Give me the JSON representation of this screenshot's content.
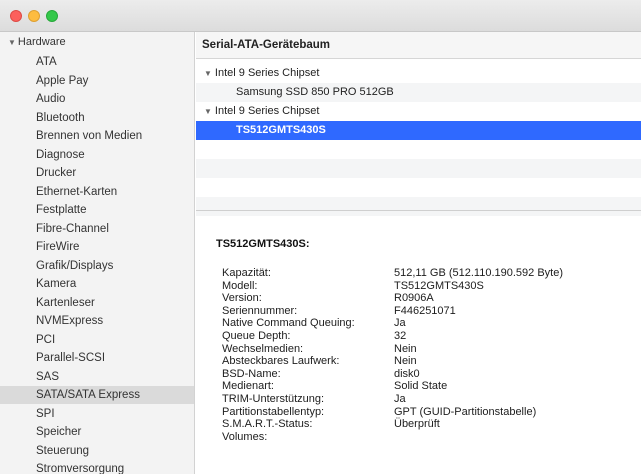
{
  "sidebar": {
    "header": "Hardware",
    "items": [
      "ATA",
      "Apple Pay",
      "Audio",
      "Bluetooth",
      "Brennen von Medien",
      "Diagnose",
      "Drucker",
      "Ethernet-Karten",
      "Festplatte",
      "Fibre-Channel",
      "FireWire",
      "Grafik/Displays",
      "Kamera",
      "Kartenleser",
      "NVMExpress",
      "PCI",
      "Parallel-SCSI",
      "SAS",
      "SATA/SATA Express",
      "SPI",
      "Speicher",
      "Steuerung",
      "Stromversorgung"
    ],
    "selected": "SATA/SATA Express"
  },
  "main": {
    "header": "Serial-ATA-Gerätebaum",
    "tree": [
      {
        "label": "Intel 9 Series Chipset",
        "kind": "group"
      },
      {
        "label": "Samsung SSD 850 PRO 512GB",
        "kind": "device"
      },
      {
        "label": "Intel 9 Series Chipset",
        "kind": "group"
      },
      {
        "label": "TS512GMTS430S",
        "kind": "device",
        "selected": true
      }
    ],
    "detail": {
      "title": "TS512GMTS430S:",
      "properties": [
        {
          "key": "Kapazität:",
          "value": "512,11 GB (512.110.190.592 Byte)"
        },
        {
          "key": "Modell:",
          "value": "TS512GMTS430S"
        },
        {
          "key": "Version:",
          "value": "R0906A"
        },
        {
          "key": "Seriennummer:",
          "value": "F446251071"
        },
        {
          "key": "Native Command Queuing:",
          "value": "Ja"
        },
        {
          "key": "Queue Depth:",
          "value": "32"
        },
        {
          "key": "Wechselmedien:",
          "value": "Nein"
        },
        {
          "key": "Absteckbares Laufwerk:",
          "value": "Nein"
        },
        {
          "key": "BSD-Name:",
          "value": "disk0"
        },
        {
          "key": "Medienart:",
          "value": "Solid State"
        },
        {
          "key": "TRIM-Unterstützung:",
          "value": "Ja"
        },
        {
          "key": "Partitionstabellentyp:",
          "value": "GPT (GUID-Partitionstabelle)"
        },
        {
          "key": "S.M.A.R.T.-Status:",
          "value": "Überprüft"
        },
        {
          "key": "Volumes:",
          "value": ""
        }
      ]
    }
  },
  "colors": {
    "selection": "#2f69ff",
    "sidebar_selection": "#dadada",
    "close": "#fc605c",
    "minimize": "#fdbc40",
    "maximize": "#34c84a"
  }
}
